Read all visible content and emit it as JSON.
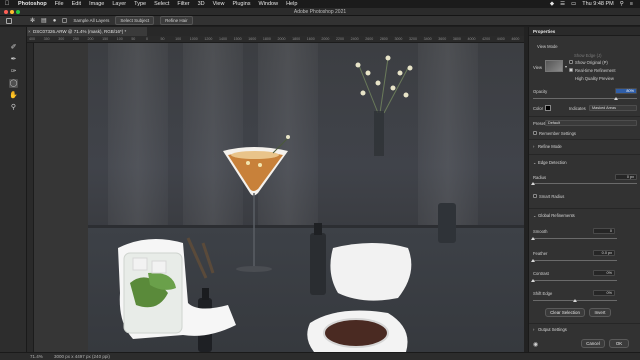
{
  "menubar": {
    "app": "Photoshop",
    "items": [
      "File",
      "Edit",
      "Image",
      "Layer",
      "Type",
      "Select",
      "Filter",
      "3D",
      "View",
      "Plugins",
      "Window",
      "Help"
    ],
    "clock": "Thu 9:48 PM"
  },
  "window": {
    "title": "Adobe Photoshop 2021"
  },
  "options": {
    "sample_all_layers": "Sample All Layers",
    "select_subject": "Select Subject",
    "refine_hair": "Refine Hair"
  },
  "document": {
    "tab_title": "DSC07326.ARW @ 71.4% (mask), RGB/16*) *",
    "close_glyph": "×"
  },
  "ruler": {
    "labels": [
      "400",
      "350",
      "300",
      "250",
      "200",
      "150",
      "100",
      "50",
      "0",
      "50",
      "100",
      "1000",
      "1200",
      "1400",
      "1500",
      "1600",
      "1800",
      "2000",
      "1800",
      "1600",
      "2000",
      "2200",
      "2400",
      "2600",
      "2800",
      "3000",
      "3200",
      "3400",
      "3600",
      "3800",
      "4000",
      "4200",
      "4400",
      "4600"
    ]
  },
  "status": {
    "zoom": "71.4%",
    "doc_size": "3000 px x 4497 px (240 ppi)"
  },
  "properties": {
    "title": "Properties",
    "view_mode": "View Mode",
    "view_label": "View",
    "show_edge": "Show Edge (J)",
    "show_original": "Show Original (P)",
    "realtime_refinement": "Real-time Refinement",
    "high_quality_preview": "High Quality Preview",
    "opacity_label": "Opacity",
    "opacity_value": "80%",
    "color_label": "Color",
    "indicates_label": "Indicates",
    "indicates_value": "Masked Areas",
    "preset_label": "Preset",
    "preset_value": "Default",
    "remember_settings": "Remember Settings",
    "refine_mode": "Refine Mode",
    "edge_detection": "Edge Detection",
    "radius_label": "Radius",
    "radius_value": "0 px",
    "smart_radius": "Smart Radius",
    "global_refinements": "Global Refinements",
    "smooth_label": "Smooth",
    "smooth_value": "0",
    "feather_label": "Feather",
    "feather_value": "0.0 px",
    "contrast_label": "Contrast",
    "contrast_value": "0%",
    "shift_edge_label": "Shift Edge",
    "shift_edge_value": "0%",
    "clear_selection": "Clear Selection",
    "invert": "Invert",
    "output_settings": "Output Settings",
    "cancel": "Cancel",
    "ok": "OK"
  }
}
